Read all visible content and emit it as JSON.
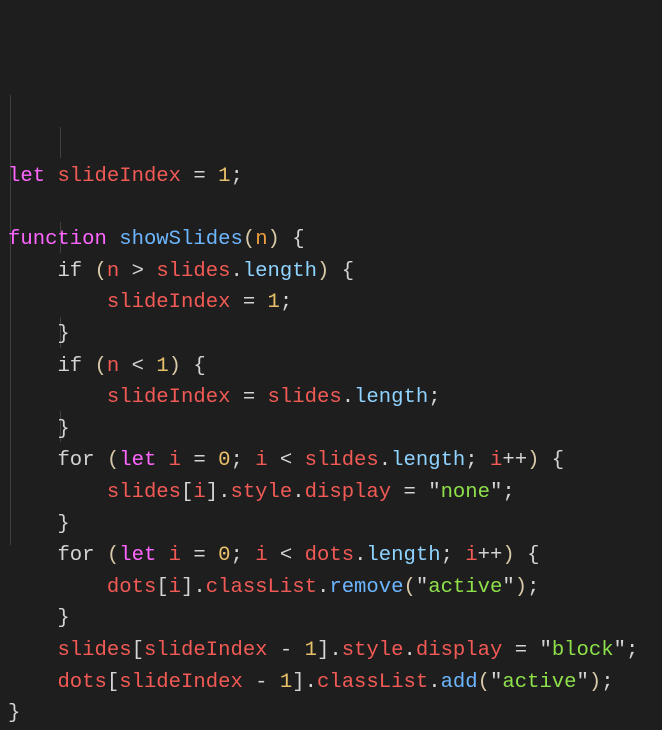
{
  "editor": {
    "lines": [
      [
        [
          "kw",
          "let"
        ],
        [
          "punc",
          " "
        ],
        [
          "var",
          "slideIndex"
        ],
        [
          "punc",
          " = "
        ],
        [
          "num",
          "1"
        ],
        [
          "punc",
          ";"
        ]
      ],
      [],
      [
        [
          "kw",
          "function"
        ],
        [
          "punc",
          " "
        ],
        [
          "fn",
          "showSlides"
        ],
        [
          "paren",
          "("
        ],
        [
          "param",
          "n"
        ],
        [
          "paren",
          ")"
        ],
        [
          "punc",
          " {"
        ]
      ],
      [
        [
          "punc",
          "    "
        ],
        [
          "ctl",
          "if"
        ],
        [
          "punc",
          " "
        ],
        [
          "paren",
          "("
        ],
        [
          "var",
          "n"
        ],
        [
          "punc",
          " > "
        ],
        [
          "var",
          "slides"
        ],
        [
          "punc",
          "."
        ],
        [
          "prop",
          "length"
        ],
        [
          "paren",
          ")"
        ],
        [
          "punc",
          " {"
        ]
      ],
      [
        [
          "punc",
          "        "
        ],
        [
          "var",
          "slideIndex"
        ],
        [
          "punc",
          " = "
        ],
        [
          "num",
          "1"
        ],
        [
          "punc",
          ";"
        ]
      ],
      [
        [
          "punc",
          "    }"
        ]
      ],
      [
        [
          "punc",
          "    "
        ],
        [
          "ctl",
          "if"
        ],
        [
          "punc",
          " "
        ],
        [
          "paren",
          "("
        ],
        [
          "var",
          "n"
        ],
        [
          "punc",
          " < "
        ],
        [
          "num",
          "1"
        ],
        [
          "paren",
          ")"
        ],
        [
          "punc",
          " {"
        ]
      ],
      [
        [
          "punc",
          "        "
        ],
        [
          "var",
          "slideIndex"
        ],
        [
          "punc",
          " = "
        ],
        [
          "var",
          "slides"
        ],
        [
          "punc",
          "."
        ],
        [
          "prop",
          "length"
        ],
        [
          "punc",
          ";"
        ]
      ],
      [
        [
          "punc",
          "    }"
        ]
      ],
      [
        [
          "punc",
          "    "
        ],
        [
          "ctl",
          "for"
        ],
        [
          "punc",
          " "
        ],
        [
          "paren",
          "("
        ],
        [
          "kw",
          "let"
        ],
        [
          "punc",
          " "
        ],
        [
          "var",
          "i"
        ],
        [
          "punc",
          " = "
        ],
        [
          "num",
          "0"
        ],
        [
          "punc",
          "; "
        ],
        [
          "var",
          "i"
        ],
        [
          "punc",
          " < "
        ],
        [
          "var",
          "slides"
        ],
        [
          "punc",
          "."
        ],
        [
          "prop",
          "length"
        ],
        [
          "punc",
          "; "
        ],
        [
          "var",
          "i"
        ],
        [
          "punc",
          "++"
        ],
        [
          "paren",
          ")"
        ],
        [
          "punc",
          " {"
        ]
      ],
      [
        [
          "punc",
          "        "
        ],
        [
          "var",
          "slides"
        ],
        [
          "punc",
          "["
        ],
        [
          "var",
          "i"
        ],
        [
          "punc",
          "]."
        ],
        [
          "var",
          "style"
        ],
        [
          "punc",
          "."
        ],
        [
          "var",
          "display"
        ],
        [
          "punc",
          " = \""
        ],
        [
          "str",
          "none"
        ],
        [
          "punc",
          "\";"
        ]
      ],
      [
        [
          "punc",
          "    }"
        ]
      ],
      [
        [
          "punc",
          "    "
        ],
        [
          "ctl",
          "for"
        ],
        [
          "punc",
          " "
        ],
        [
          "paren",
          "("
        ],
        [
          "kw",
          "let"
        ],
        [
          "punc",
          " "
        ],
        [
          "var",
          "i"
        ],
        [
          "punc",
          " = "
        ],
        [
          "num",
          "0"
        ],
        [
          "punc",
          "; "
        ],
        [
          "var",
          "i"
        ],
        [
          "punc",
          " < "
        ],
        [
          "var",
          "dots"
        ],
        [
          "punc",
          "."
        ],
        [
          "prop",
          "length"
        ],
        [
          "punc",
          "; "
        ],
        [
          "var",
          "i"
        ],
        [
          "punc",
          "++"
        ],
        [
          "paren",
          ")"
        ],
        [
          "punc",
          " {"
        ]
      ],
      [
        [
          "punc",
          "        "
        ],
        [
          "var",
          "dots"
        ],
        [
          "punc",
          "["
        ],
        [
          "var",
          "i"
        ],
        [
          "punc",
          "]."
        ],
        [
          "var",
          "classList"
        ],
        [
          "punc",
          "."
        ],
        [
          "fn",
          "remove"
        ],
        [
          "paren",
          "("
        ],
        [
          "punc",
          "\""
        ],
        [
          "str",
          "active"
        ],
        [
          "punc",
          "\""
        ],
        [
          "paren",
          ")"
        ],
        [
          "punc",
          ";"
        ]
      ],
      [
        [
          "punc",
          "    }"
        ]
      ],
      [
        [
          "punc",
          "    "
        ],
        [
          "var",
          "slides"
        ],
        [
          "punc",
          "["
        ],
        [
          "var",
          "slideIndex"
        ],
        [
          "punc",
          " - "
        ],
        [
          "num",
          "1"
        ],
        [
          "punc",
          "]."
        ],
        [
          "var",
          "style"
        ],
        [
          "punc",
          "."
        ],
        [
          "var",
          "display"
        ],
        [
          "punc",
          " = \""
        ],
        [
          "str",
          "block"
        ],
        [
          "punc",
          "\";"
        ]
      ],
      [
        [
          "punc",
          "    "
        ],
        [
          "var",
          "dots"
        ],
        [
          "punc",
          "["
        ],
        [
          "var",
          "slideIndex"
        ],
        [
          "punc",
          " - "
        ],
        [
          "num",
          "1"
        ],
        [
          "punc",
          "]."
        ],
        [
          "var",
          "classList"
        ],
        [
          "punc",
          "."
        ],
        [
          "fn",
          "add"
        ],
        [
          "paren",
          "("
        ],
        [
          "punc",
          "\""
        ],
        [
          "str",
          "active"
        ],
        [
          "punc",
          "\""
        ],
        [
          "paren",
          ")"
        ],
        [
          "punc",
          ";"
        ]
      ],
      [
        [
          "punc",
          "}"
        ]
      ]
    ]
  }
}
